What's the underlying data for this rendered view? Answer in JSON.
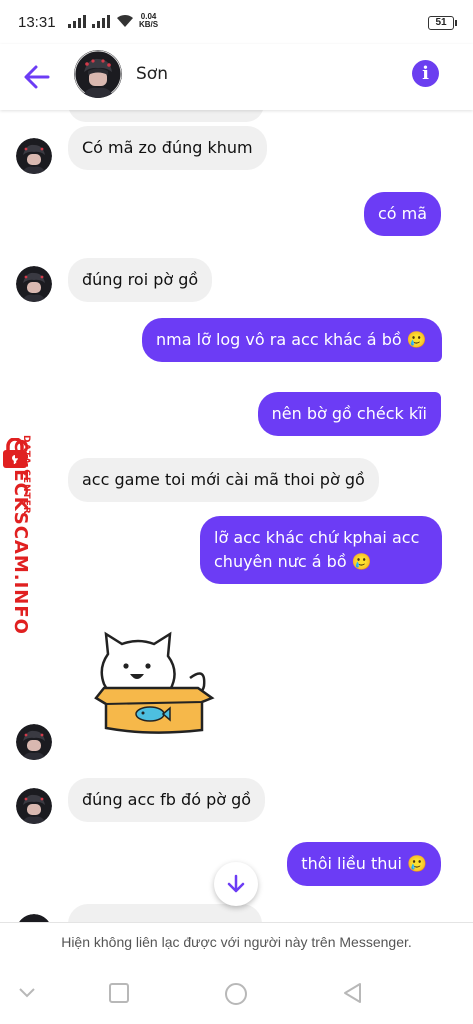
{
  "status_bar": {
    "time": "13:31",
    "speed_value": "0.04",
    "speed_unit": "KB/S",
    "battery": "51"
  },
  "header": {
    "contact_name": "Sơn",
    "info_symbol": "i"
  },
  "messages": [
    {
      "from": "them",
      "text": "Có mã zo đúng khum"
    },
    {
      "from": "me",
      "text": "có mã"
    },
    {
      "from": "them",
      "text": "đúng roi pờ gồ"
    },
    {
      "from": "me",
      "text": "nma lỡ log vô ra acc khác á bồ 🥲"
    },
    {
      "from": "me",
      "text": "nên bờ gồ chéck kĩi"
    },
    {
      "from": "them",
      "text": "acc game toi mới cài mã thoi pờ gồ"
    },
    {
      "from": "me",
      "text": "lỡ acc khác chứ kphai acc chuyên nưc á bồ 🥲"
    },
    {
      "from": "them",
      "type": "sticker",
      "icon": "cat-in-box-sticker"
    },
    {
      "from": "them",
      "text": "đúng acc fb đó pờ gồ"
    },
    {
      "from": "me",
      "text": "thôi liều thui 🥲"
    }
  ],
  "footer": {
    "notice": "Hiện không liên lạc được với người này trên Messenger."
  },
  "watermark": {
    "brand": "CHECKSCAM.INFO",
    "sub": "DATA CENTER"
  },
  "colors": {
    "accent": "#6c3cf5",
    "incoming_bubble": "#f0f0f0",
    "watermark": "#e02020"
  }
}
